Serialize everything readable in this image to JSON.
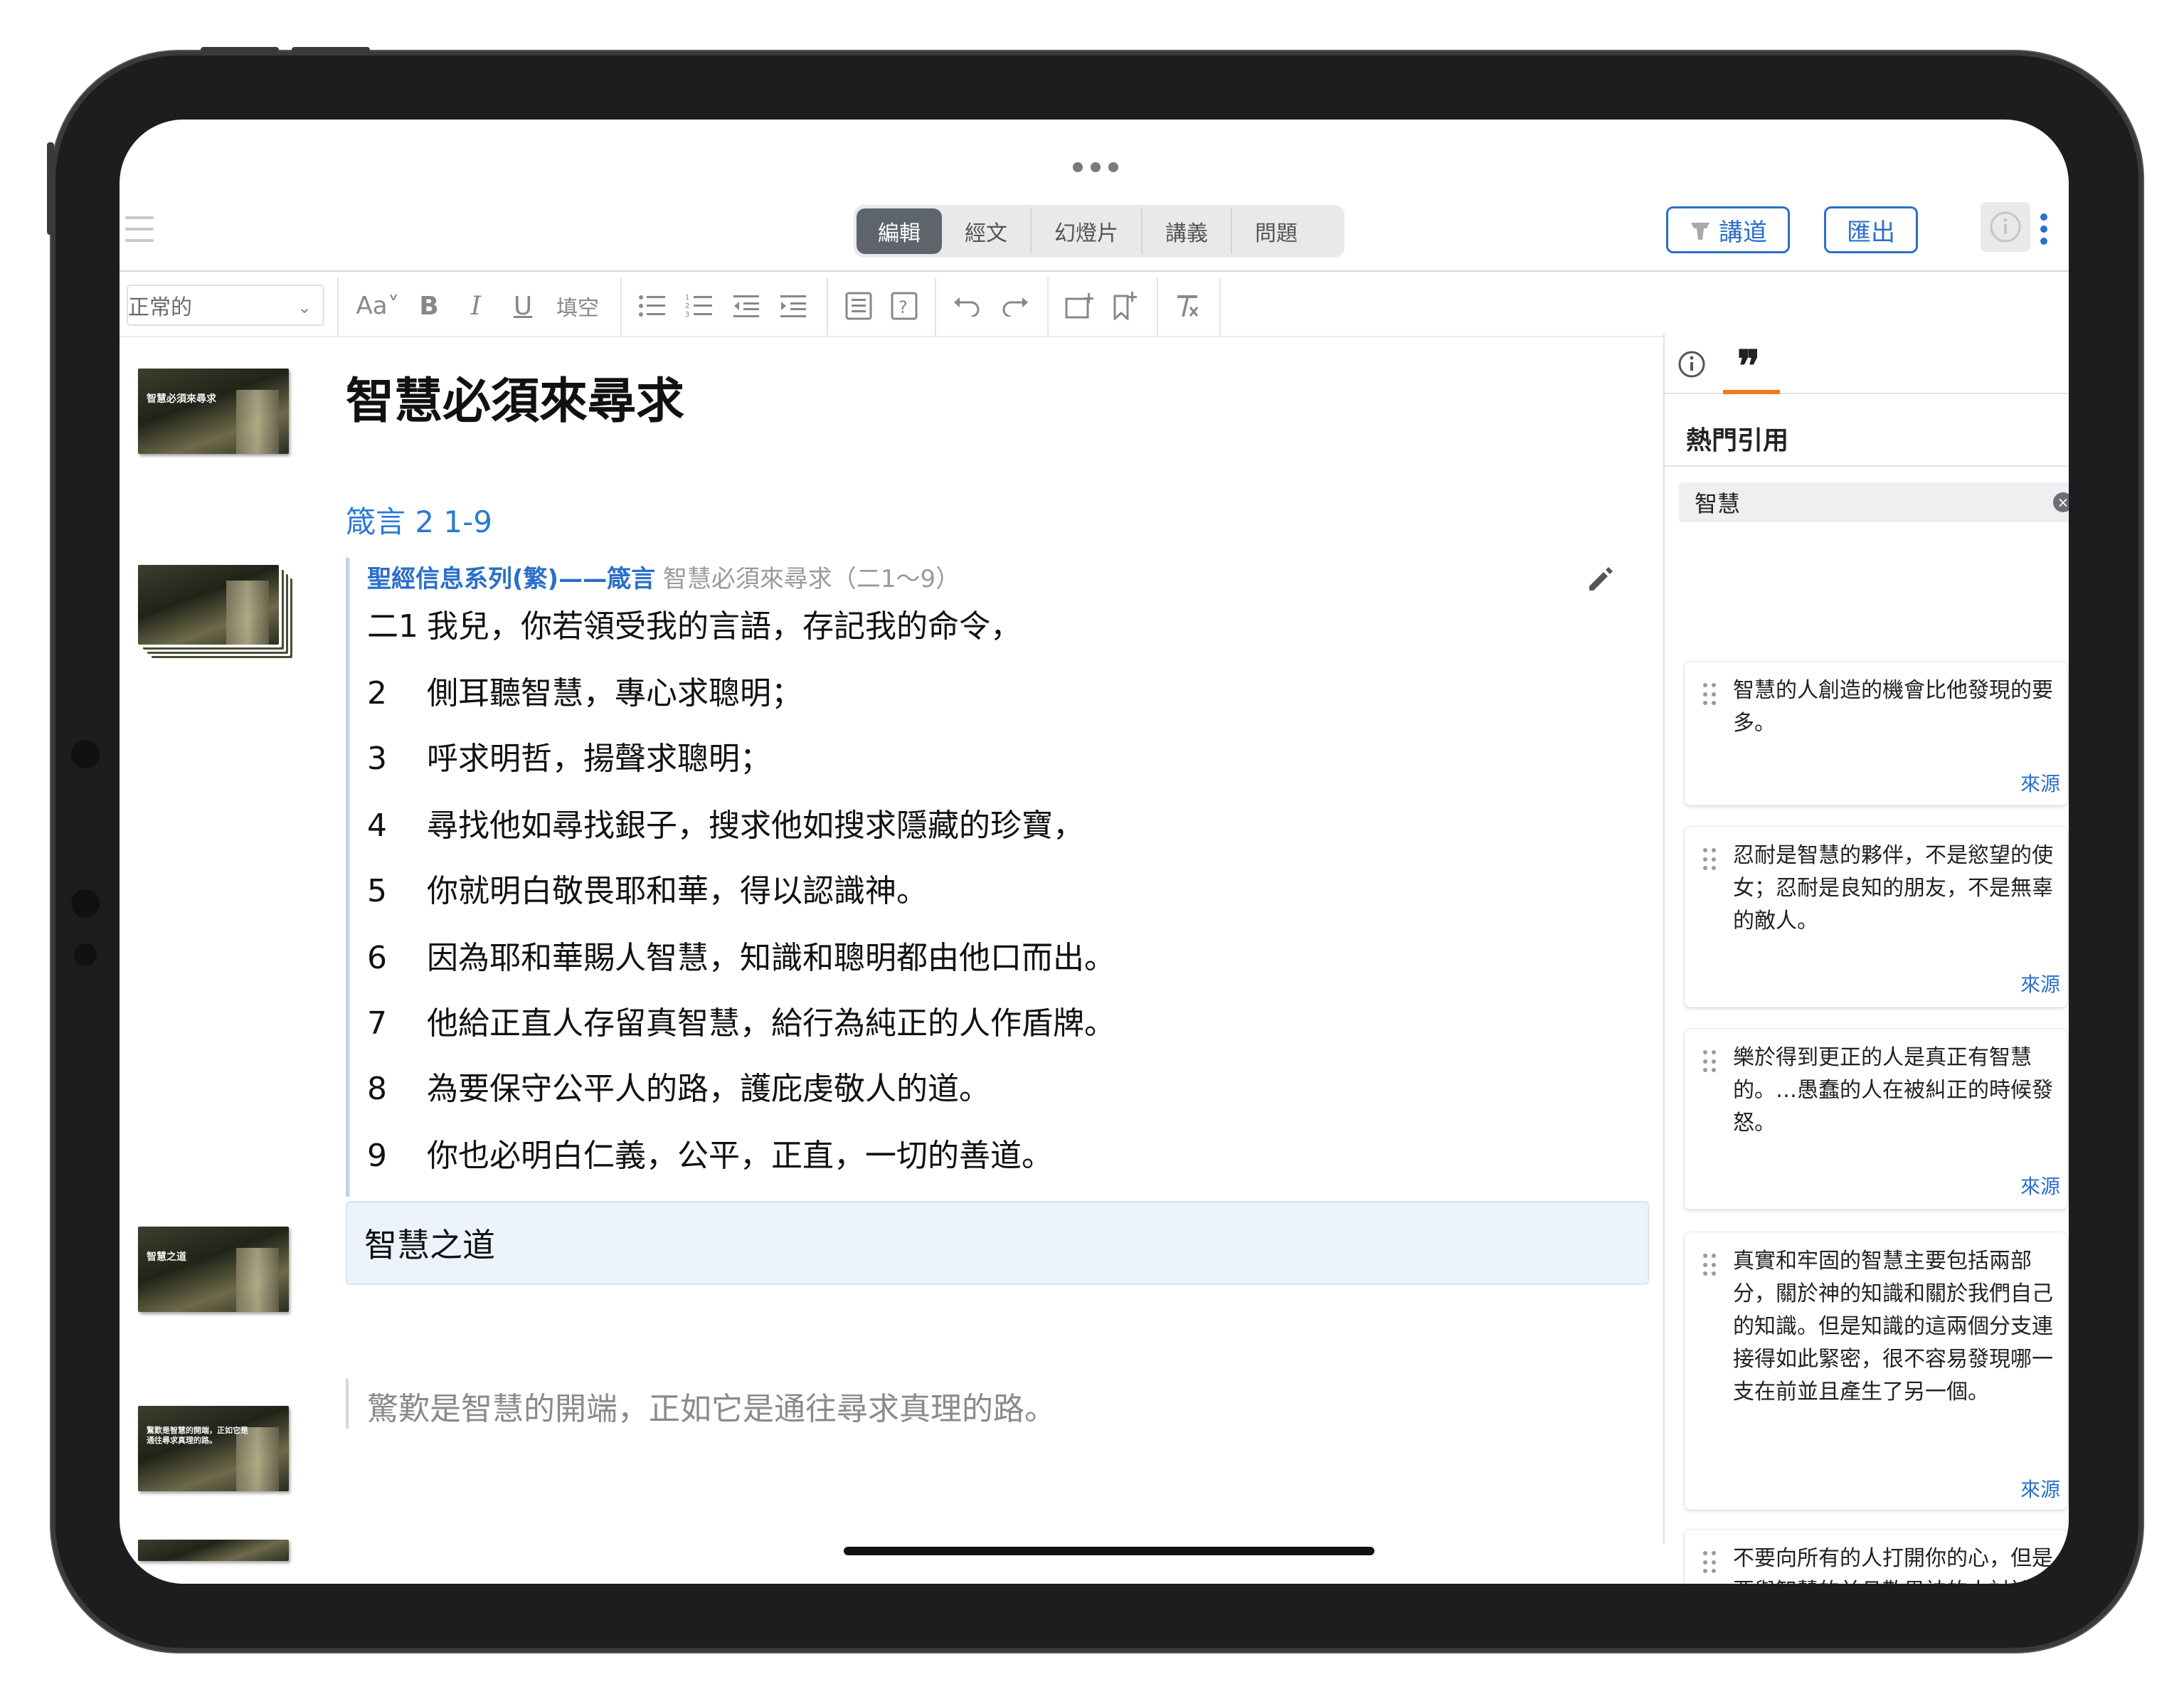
{
  "segmented_tabs": [
    "編輯",
    "經文",
    "幻燈片",
    "講義",
    "問題"
  ],
  "header_buttons": {
    "preach": "講道",
    "export": "匯出"
  },
  "toolbar": {
    "style_select": "正常的",
    "fill_blank": "填空"
  },
  "slides": [
    {
      "label": "智慧必須來尋求"
    },
    {
      "label": ""
    },
    {
      "label": "智慧之道"
    },
    {
      "label": "驚歎是智慧的開端，正如它是通往尋求真理的路。"
    }
  ],
  "main": {
    "title": "智慧必須來尋求",
    "scripture_ref": "箴言 2 1-9",
    "source_link": "聖經信息系列(繁)——箴言",
    "source_sub": "智慧必須來尋求（二1～9）",
    "verses": [
      {
        "num": "二1",
        "text": "我兒，你若領受我的言語，存記我的命令，"
      },
      {
        "num": "2",
        "text": "側耳聽智慧，專心求聰明；"
      },
      {
        "num": "3",
        "text": "呼求明哲，揚聲求聰明；"
      },
      {
        "num": "4",
        "text": "尋找他如尋找銀子，搜求他如搜求隱藏的珍寶，"
      },
      {
        "num": "5",
        "text": "你就明白敬畏耶和華，得以認識神。"
      },
      {
        "num": "6",
        "text": "因為耶和華賜人智慧，知識和聰明都由他口而出。"
      },
      {
        "num": "7",
        "text": "他給正直人存留真智慧，給行為純正的人作盾牌。"
      },
      {
        "num": "8",
        "text": "為要保守公平人的路，護庇虔敬人的道。"
      },
      {
        "num": "9",
        "text": "你也必明白仁義，公平，正直，一切的善道。"
      }
    ],
    "heading": "智慧之道",
    "quote": "驚歎是智慧的開端，正如它是通往尋求真理的路。"
  },
  "panel": {
    "title": "熱門引用",
    "search_value": "智慧",
    "quotes": [
      {
        "text": "智慧的人創造的機會比他發現的要多。",
        "source": "來源"
      },
      {
        "text": "忍耐是智慧的夥伴，不是慾望的使女；忍耐是良知的朋友，不是無辜的敵人。",
        "source": "來源"
      },
      {
        "text": "樂於得到更正的人是真正有智慧的。…愚蠢的人在被糾正的時候發怒。",
        "source": "來源"
      },
      {
        "text": "真實和牢固的智慧主要包括兩部分，關於神的知識和關於我們自己的知識。但是知識的這兩個分支連接得如此緊密，很不容易發現哪一支在前並且產生了另一個。",
        "source": "來源"
      },
      {
        "text": "不要向所有的人打開你的心，但是要與智慧的並且敬畏神的人討論你的事情。",
        "source": ""
      }
    ]
  },
  "colors": {
    "accent": "#2a6fc9",
    "tab_underline": "#f07a1a",
    "active_tab": "#5d646b"
  }
}
